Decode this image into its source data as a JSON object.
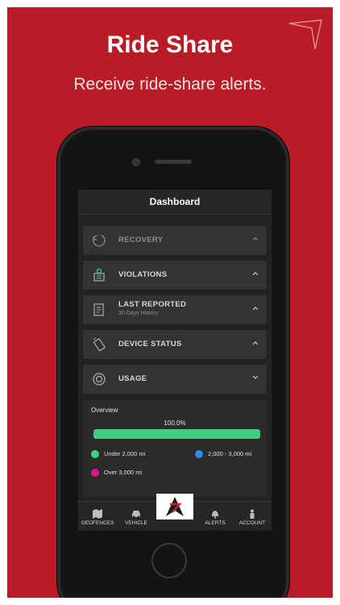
{
  "headline": "Ride Share",
  "subline": "Receive ride-share alerts.",
  "screen": {
    "title": "Dashboard",
    "rows": [
      {
        "label": "RECOVERY",
        "icon": "refresh-icon"
      },
      {
        "label": "VIOLATIONS",
        "icon": "violations-icon"
      },
      {
        "label": "LAST REPORTED",
        "sub": "30 Days History",
        "icon": "report-icon"
      },
      {
        "label": "DEVICE STATUS",
        "icon": "device-icon"
      },
      {
        "label": "USAGE",
        "icon": "usage-icon"
      }
    ],
    "usage": {
      "overview": "Overview",
      "percent_text": "100.0%",
      "fill_fraction": 1.0,
      "legend": [
        {
          "label": "Under 2,000 mi",
          "color": "#3ecf82"
        },
        {
          "label": "2,000 - 3,000 mi",
          "color": "#2b8ce6"
        },
        {
          "label": "Over 3,000 mi",
          "color": "#e6147f"
        }
      ]
    },
    "tabs": [
      {
        "label": "GEOFENCES",
        "icon": "map-icon"
      },
      {
        "label": "VEHICLE",
        "icon": "car-icon"
      },
      {
        "label": "",
        "icon": "brand-logo-icon"
      },
      {
        "label": "ALERTS",
        "icon": "bell-icon"
      },
      {
        "label": "ACCOUNT",
        "icon": "person-icon"
      }
    ]
  },
  "colors": {
    "background": "#b71c27",
    "accent_green": "#3ecf82"
  }
}
